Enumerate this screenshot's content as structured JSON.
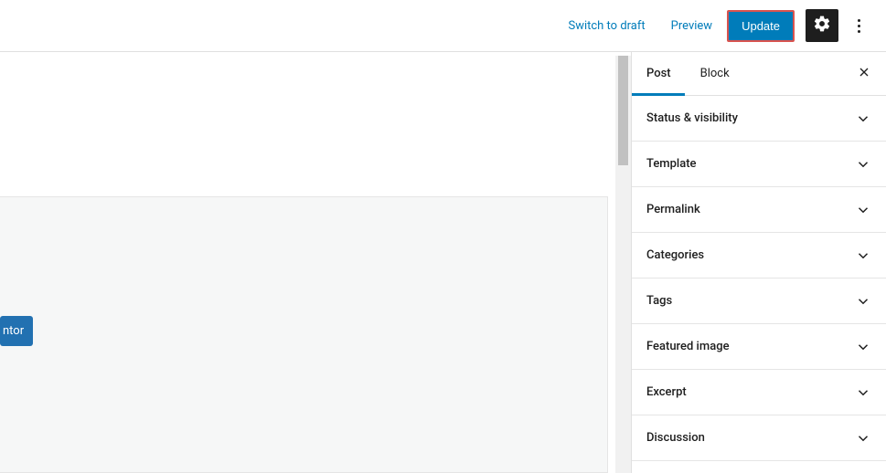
{
  "topbar": {
    "switch_draft": "Switch to draft",
    "preview": "Preview",
    "update": "Update"
  },
  "editor_button": "ntor",
  "sidebar": {
    "tabs": {
      "post": "Post",
      "block": "Block"
    },
    "panels": [
      {
        "label": "Status & visibility"
      },
      {
        "label": "Template"
      },
      {
        "label": "Permalink"
      },
      {
        "label": "Categories"
      },
      {
        "label": "Tags"
      },
      {
        "label": "Featured image"
      },
      {
        "label": "Excerpt"
      },
      {
        "label": "Discussion"
      }
    ]
  },
  "colors": {
    "accent": "#007cba",
    "highlight_border": "#d9534f",
    "dark": "#1e1e1e"
  }
}
